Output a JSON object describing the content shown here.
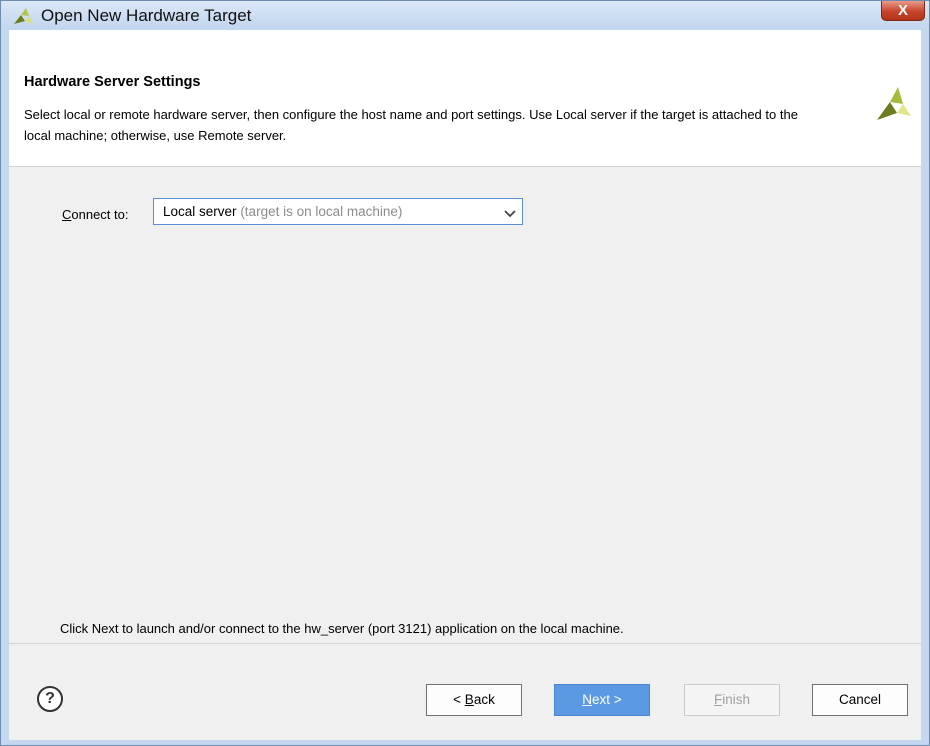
{
  "window": {
    "title": "Open New Hardware Target",
    "close_label": "X",
    "title_icon": "vivado-logo-icon",
    "close_icon": "close-icon"
  },
  "header": {
    "title": "Hardware Server Settings",
    "description": "Select local or remote hardware server, then configure the host name and port settings. Use Local server if the target is attached to the local machine; otherwise, use Remote server.",
    "logo_icon": "vivado-logo-icon"
  },
  "connect": {
    "label_mnemonic": "C",
    "label_rest": "onnect to:",
    "selected_value": "Local server",
    "selected_hint": "(target is on local machine)",
    "chevron_icon": "chevron-down-icon"
  },
  "info_text": "Click Next to launch and/or connect to the hw_server (port 3121) application on the local machine.",
  "footer": {
    "help_label": "?",
    "back_prefix": "< ",
    "back_mnemonic": "B",
    "back_rest": "ack",
    "next_mnemonic": "N",
    "next_rest": "ext >",
    "finish_mnemonic": "F",
    "finish_rest": "inish",
    "cancel_label": "Cancel"
  },
  "colors": {
    "accent": "#5b9ae3",
    "select_border": "#5a8fd6",
    "close_red": "#c7452c",
    "logo_yellow": "#8da23b"
  }
}
